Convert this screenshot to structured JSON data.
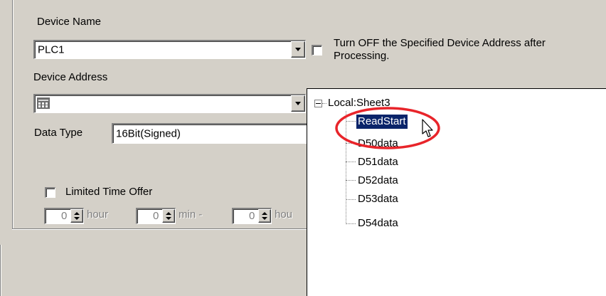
{
  "form": {
    "device_name_label": "Device Name",
    "device_name_value": "PLC1",
    "turn_off_label_line1": "Turn OFF the Specified Device Address after",
    "turn_off_label_line2": "Processing.",
    "device_address_label": "Device Address",
    "device_address_value": "",
    "data_type_label": "Data Type",
    "data_type_value": "16Bit(Signed)",
    "limited_time_label": "Limited Time Offer",
    "spinners": [
      {
        "value": "0",
        "unit": "hour"
      },
      {
        "value": "0",
        "unit": "min -"
      },
      {
        "value": "0",
        "unit": "hou"
      }
    ]
  },
  "tree": {
    "root_label": "Local:Sheet3",
    "items": [
      {
        "label": "ReadStart",
        "selected": true
      },
      {
        "label": "D50data",
        "selected": false
      },
      {
        "label": "D51data",
        "selected": false
      },
      {
        "label": "D52data",
        "selected": false
      },
      {
        "label": "D53data",
        "selected": false
      },
      {
        "label": "D54data",
        "selected": false
      }
    ]
  },
  "colors": {
    "panel": "#d4d0c8",
    "selection": "#0a246a",
    "highlight_circle": "#e8242a"
  }
}
